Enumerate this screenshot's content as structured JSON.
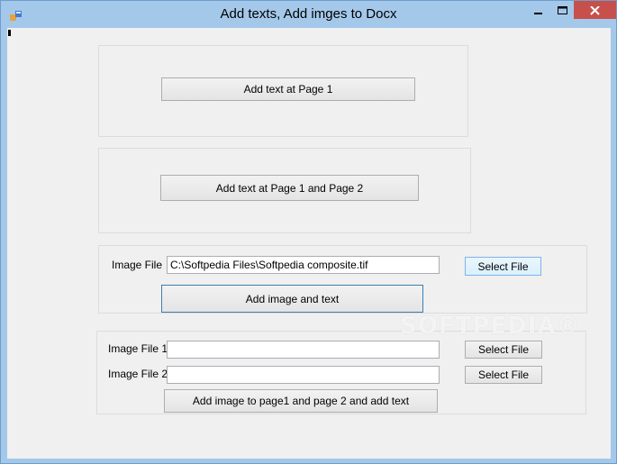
{
  "window": {
    "title": "Add texts, Add imges to Docx",
    "titlebar_color": "#a4c8ea",
    "close_color": "#c7504c"
  },
  "group1": {
    "button_label": "Add text at Page 1"
  },
  "group2": {
    "button_label": "Add text at Page 1 and Page 2"
  },
  "group3": {
    "image_label": "Image File",
    "image_path": "C:\\Softpedia Files\\Softpedia composite.tif",
    "select_label": "Select File",
    "add_label": "Add image and text"
  },
  "group4": {
    "image1_label": "Image File 1",
    "image1_value": "",
    "select1_label": "Select File",
    "image2_label": "Image File 2",
    "image2_value": "",
    "select2_label": "Select File",
    "add_label": "Add image to page1 and page 2 and add text"
  },
  "watermark": "SOFTPEDIA®"
}
